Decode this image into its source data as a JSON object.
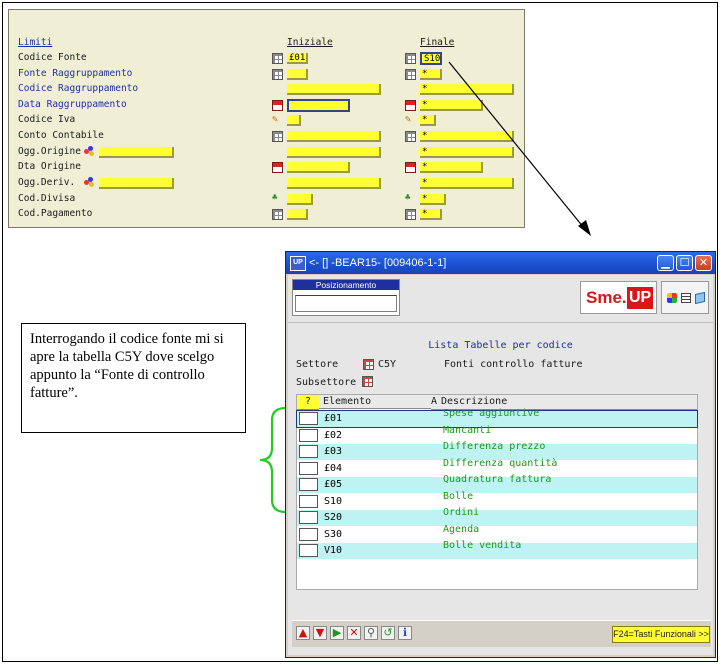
{
  "form": {
    "header_limiti": "Limiti",
    "header_iniziale": "Iniziale",
    "header_finale": "Finale",
    "rows": [
      {
        "label": "Codice Fonte",
        "iniziale": "£01",
        "finale": "S10"
      },
      {
        "label": "Fonte  Raggruppamento",
        "iniziale": "",
        "finale": "*"
      },
      {
        "label": "Codice Raggruppamento",
        "iniziale": "",
        "finale": "*"
      },
      {
        "label": "Data   Raggruppamento",
        "iniziale": "",
        "finale": "*"
      },
      {
        "label": "Codice Iva",
        "iniziale": "",
        "finale": "*"
      },
      {
        "label": "Conto  Contabile",
        "iniziale": "",
        "finale": "*"
      },
      {
        "label": "Ogg.Origine",
        "iniziale": "",
        "finale": "*"
      },
      {
        "label": "Dta Origine",
        "iniziale": "",
        "finale": "*"
      },
      {
        "label": "Ogg.Deriv.",
        "iniziale": "",
        "finale": "*"
      },
      {
        "label": "Cod.Divisa",
        "iniziale": "",
        "finale": "*"
      },
      {
        "label": "Cod.Pagamento",
        "iniziale": "",
        "finale": "*"
      }
    ]
  },
  "callout": {
    "text": "Interrogando il codice fonte mi si apre la tabella C5Y dove scelgo appunto la “Fonte di controllo fatture”."
  },
  "window": {
    "app_icon": "UP",
    "title": "<- [] -BEAR15- [009406-1-1]",
    "posizionamento_label": "Posizionamento",
    "logo_sme": "Sme.",
    "logo_up": "UP",
    "list_title": "Lista Tabelle per codice",
    "settore_label": "Settore",
    "settore_value": "C5Y",
    "settore_desc": "Fonti controllo fatture",
    "subsettore_label": "Subsettore",
    "table": {
      "col_q": "?",
      "col_elemento": "Elemento",
      "col_a": "A",
      "col_descrizione": "Descrizione",
      "rows": [
        {
          "code": "£01",
          "desc": "Spese aggiuntive"
        },
        {
          "code": "£02",
          "desc": "Mancanti"
        },
        {
          "code": "£03",
          "desc": "Differenza prezzo"
        },
        {
          "code": "£04",
          "desc": "Differenza quantità"
        },
        {
          "code": "£05",
          "desc": "Quadratura fattura"
        },
        {
          "code": "S10",
          "desc": "Bolle"
        },
        {
          "code": "S20",
          "desc": "Ordini"
        },
        {
          "code": "S30",
          "desc": "Agenda"
        },
        {
          "code": "V10",
          "desc": "Bolle vendita"
        }
      ]
    },
    "f24_label": "F24=Tasti Funzionali >>"
  },
  "colors": {
    "form_bg": "#f0efd6",
    "field_yellow": "#ffff33",
    "label_blue": "#1f2fa0",
    "row_alt": "#bff2f2",
    "desc_green": "#1a9a1a",
    "brace_green": "#22cc22",
    "titlebar_blue": "#2b6be8"
  }
}
